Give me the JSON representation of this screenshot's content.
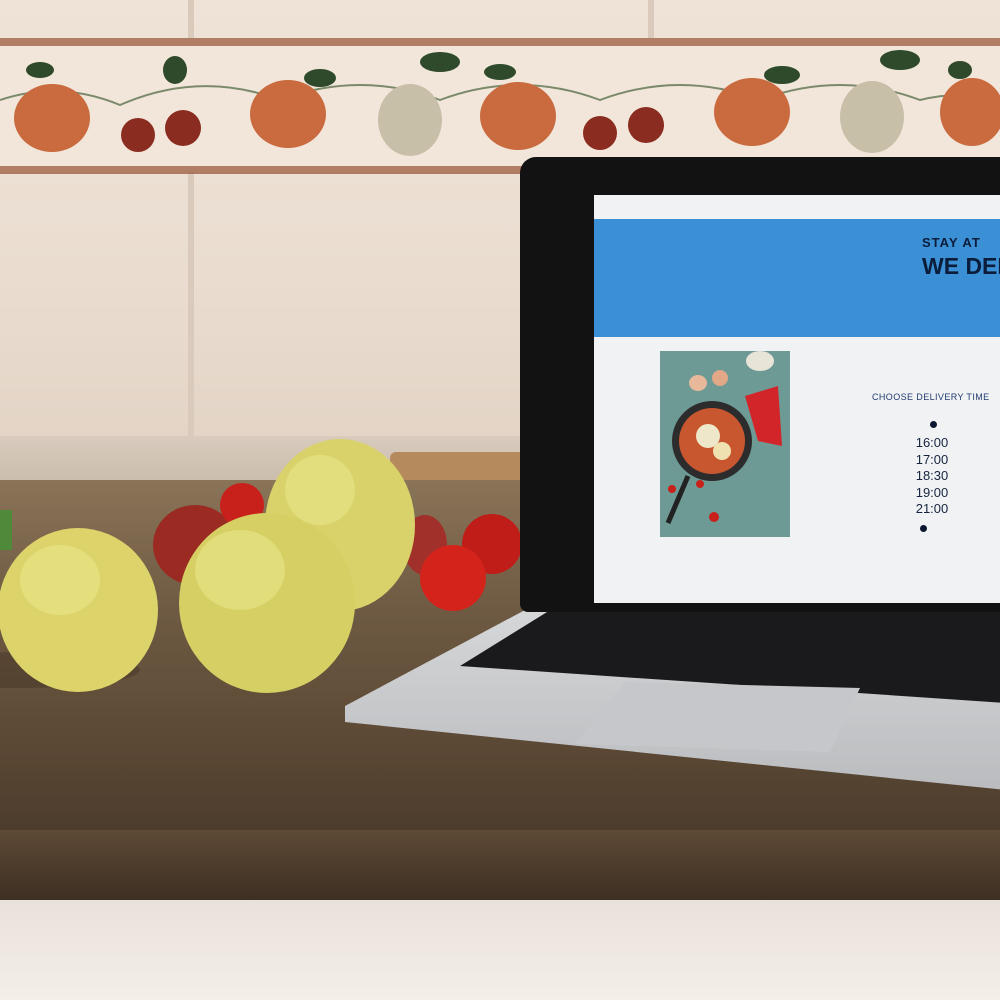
{
  "webpage": {
    "hero_line1": "STAY AT",
    "hero_line2": "WE DEL",
    "delivery_title": "CHOOSE DELIVERY TIME",
    "times": [
      "16:00",
      "17:00",
      "18:30",
      "19:00",
      "21:00"
    ]
  },
  "colors": {
    "hero_blue": "#3b8fd4",
    "screen_bg": "#f1f2f4",
    "heading_navy": "#0b1d3a",
    "apple_yellow": "#d9d26a",
    "tomato_red": "#c8201a"
  }
}
